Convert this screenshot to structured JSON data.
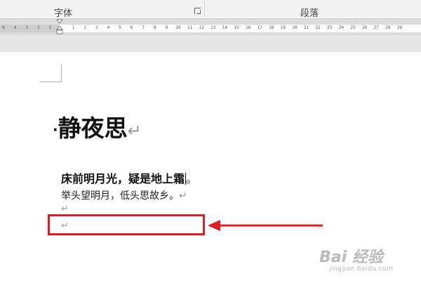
{
  "ribbon": {
    "groups": [
      {
        "label": "字体"
      },
      {
        "label": "段落"
      }
    ],
    "launcher_icon": "dialog-launcher-icon"
  },
  "ruler": {
    "ticks": [
      "6",
      "4",
      "3",
      "2",
      "1",
      "",
      "1",
      "2",
      "3",
      "4",
      "5",
      "6",
      "7",
      "8",
      "9",
      "10",
      "11",
      "12",
      "13",
      "14",
      "15",
      "16",
      "17",
      "18",
      "19",
      "20",
      "21",
      "22",
      "23",
      "24",
      "25",
      "26",
      "27",
      "28",
      "29"
    ]
  },
  "document": {
    "title": "静夜思",
    "line1_selected": "床前明月光，疑是地上霜",
    "line1_tail": "。",
    "line2": "举头望明月，低头思故乡。",
    "pilcrow": "↵",
    "bullet": "·"
  },
  "annotation": {
    "color": "#e31b23"
  },
  "watermark": {
    "brand": "Bai 经验",
    "sub": "jingyan.baidu.com"
  }
}
